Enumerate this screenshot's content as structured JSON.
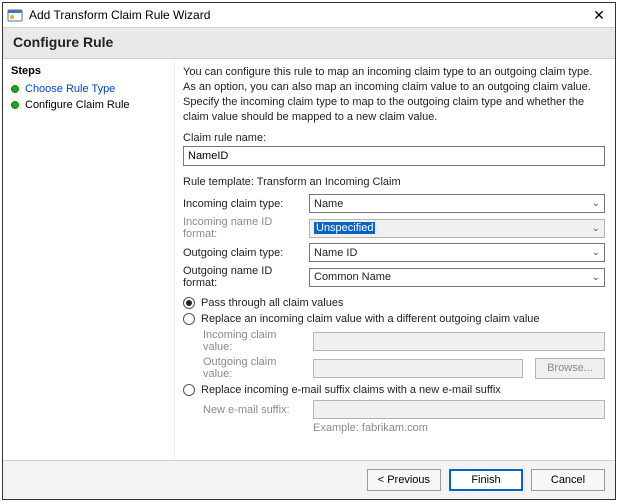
{
  "window": {
    "title": "Add Transform Claim Rule Wizard"
  },
  "banner": "Configure Rule",
  "sidebar": {
    "header": "Steps",
    "items": [
      {
        "label": "Choose Rule Type"
      },
      {
        "label": "Configure Claim Rule"
      }
    ]
  },
  "main": {
    "description": "You can configure this rule to map an incoming claim type to an outgoing claim type. As an option, you can also map an incoming claim value to an outgoing claim value. Specify the incoming claim type to map to the outgoing claim type and whether the claim value should be mapped to a new claim value.",
    "claim_rule_name_label": "Claim rule name:",
    "claim_rule_name_value": "NameID",
    "rule_template_label": "Rule template: Transform an Incoming Claim",
    "incoming_claim_type_label": "Incoming claim type:",
    "incoming_claim_type_value": "Name",
    "incoming_name_id_format_label": "Incoming name ID format:",
    "incoming_name_id_format_value": "Unspecified",
    "outgoing_claim_type_label": "Outgoing claim type:",
    "outgoing_claim_type_value": "Name ID",
    "outgoing_name_id_format_label": "Outgoing name ID format:",
    "outgoing_name_id_format_value": "Common Name",
    "radios": {
      "pass_through": "Pass through all claim values",
      "replace_value": "Replace an incoming claim value with a different outgoing claim value",
      "incoming_claim_value_label": "Incoming claim value:",
      "outgoing_claim_value_label": "Outgoing claim value:",
      "browse": "Browse...",
      "replace_suffix": "Replace incoming e-mail suffix claims with a new e-mail suffix",
      "new_email_suffix_label": "New e-mail suffix:",
      "example": "Example: fabrikam.com"
    }
  },
  "footer": {
    "previous": "< Previous",
    "finish": "Finish",
    "cancel": "Cancel"
  }
}
